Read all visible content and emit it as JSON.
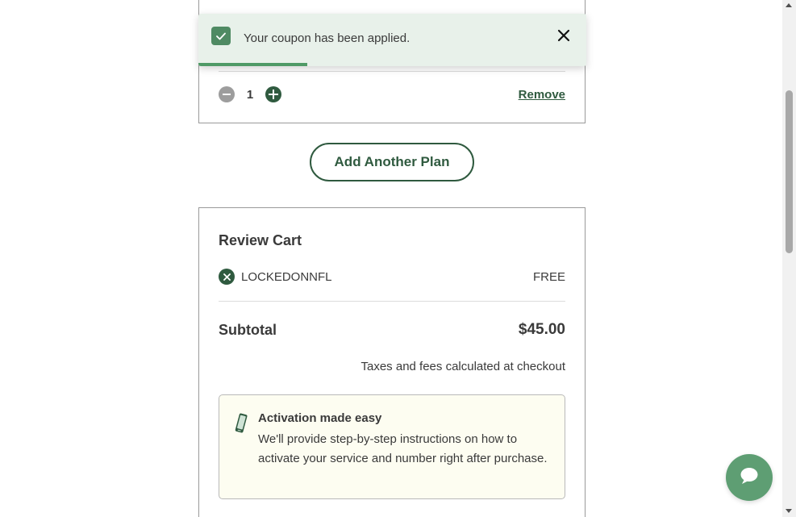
{
  "toast": {
    "message": "Your coupon has been applied.",
    "progress_fraction": 0.28,
    "icons": {
      "status": "check-icon",
      "close": "close-icon"
    }
  },
  "plan_item": {
    "quantity": "1",
    "remove_label": "Remove",
    "icons": {
      "decrease": "minus-icon",
      "increase": "plus-icon"
    }
  },
  "add_plan_button": "Add Another Plan",
  "review_cart": {
    "title": "Review Cart",
    "coupon": {
      "code": "LOCKEDONNFL",
      "price": "FREE",
      "remove_icon": "close-icon"
    },
    "subtotal_label": "Subtotal",
    "subtotal_value": "$45.00",
    "taxes_note": "Taxes and fees calculated at checkout",
    "activation": {
      "icon": "phone-icon",
      "title": "Activation made easy",
      "text": "We'll provide step-by-step instructions on how to activate your service and number right after purchase."
    }
  },
  "chat": {
    "icon": "chat-icon"
  },
  "colors": {
    "brand_dark_green": "#2f5a3f",
    "toast_background": "#e8f1ea",
    "toast_progress": "#4f9a66",
    "chat_button": "#5e9e73",
    "activation_background": "#fdfdf1"
  }
}
